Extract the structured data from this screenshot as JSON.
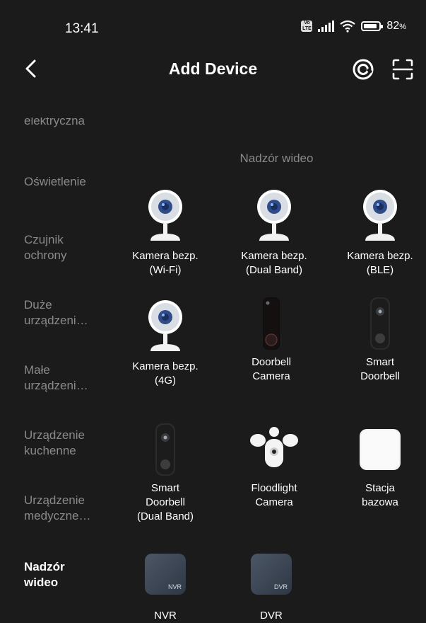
{
  "status": {
    "time": "13:41",
    "volte_text": "Vo LTE",
    "battery_pct": "82",
    "battery_unit": "%"
  },
  "header": {
    "title": "Add Device"
  },
  "sidebar": {
    "items": [
      {
        "label": "elektryczna",
        "active": false
      },
      {
        "label": "Oświetlenie",
        "active": false
      },
      {
        "label": "Czujnik\nochrony",
        "active": false
      },
      {
        "label": "Duże\nurządzeni…",
        "active": false
      },
      {
        "label": "Małe\nurządzeni…",
        "active": false
      },
      {
        "label": "Urządzenie\nkuchenne",
        "active": false
      },
      {
        "label": "Urządzenie\nmedyczne…",
        "active": false
      },
      {
        "label": "Nadzór\nwideo",
        "active": true
      }
    ]
  },
  "section": {
    "title": "Nadzór wideo"
  },
  "devices": [
    {
      "label": "Kamera bezp.\n(Wi-Fi)",
      "icon": "camera-icon"
    },
    {
      "label": "Kamera bezp.\n(Dual Band)",
      "icon": "camera-icon"
    },
    {
      "label": "Kamera bezp.\n(BLE)",
      "icon": "camera-icon"
    },
    {
      "label": "Kamera bezp.\n(4G)",
      "icon": "camera-icon"
    },
    {
      "label": "Doorbell\nCamera",
      "icon": "doorbell-camera-icon"
    },
    {
      "label": "Smart\nDoorbell",
      "icon": "smart-doorbell-icon"
    },
    {
      "label": "Smart\nDoorbell\n(Dual Band)",
      "icon": "smart-doorbell-icon"
    },
    {
      "label": "Floodlight\nCamera",
      "icon": "floodlight-camera-icon"
    },
    {
      "label": "Stacja\nbazowa",
      "icon": "base-station-icon"
    },
    {
      "label": "NVR",
      "icon": "nvr-icon",
      "badge": "NVR"
    },
    {
      "label": "DVR",
      "icon": "dvr-icon",
      "badge": "DVR"
    }
  ]
}
